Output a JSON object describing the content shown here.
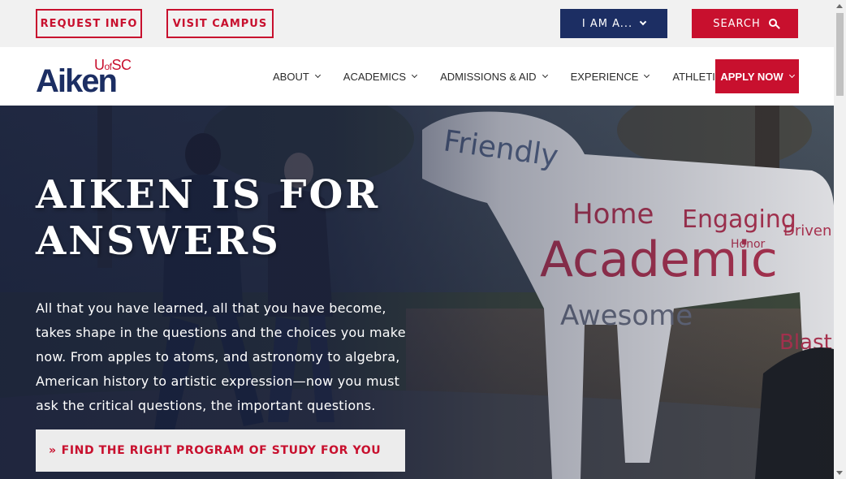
{
  "utility": {
    "request_info": "REQUEST INFO",
    "visit_campus": "VISIT CAMPUS",
    "i_am_a": "I AM A...",
    "search": "SEARCH"
  },
  "logo": {
    "small_u": "U",
    "small_of": "of",
    "small_sc": "SC",
    "main": "Aiken"
  },
  "nav": {
    "items": [
      {
        "label": "ABOUT"
      },
      {
        "label": "ACADEMICS"
      },
      {
        "label": "ADMISSIONS & AID"
      },
      {
        "label": "EXPERIENCE"
      },
      {
        "label": "ATHLETICS"
      }
    ],
    "apply": "APPLY NOW"
  },
  "hero": {
    "title": "AIKEN IS FOR ANSWERS",
    "body": "All that you have learned, all that you have become, takes shape in the questions and the choices you make now. From apples to atoms, and astronomy to algebra, American history to artistic expression—now you must ask the critical questions, the important questions.",
    "cta": "FIND THE RIGHT PROGRAM OF STUDY FOR YOU",
    "statue_words": [
      "Friendly",
      "Home",
      "Engaging",
      "Academic",
      "Awesome",
      "Driven",
      "Blast",
      "Honor"
    ]
  },
  "colors": {
    "brand_red": "#c8102e",
    "brand_navy": "#1c2e63"
  }
}
